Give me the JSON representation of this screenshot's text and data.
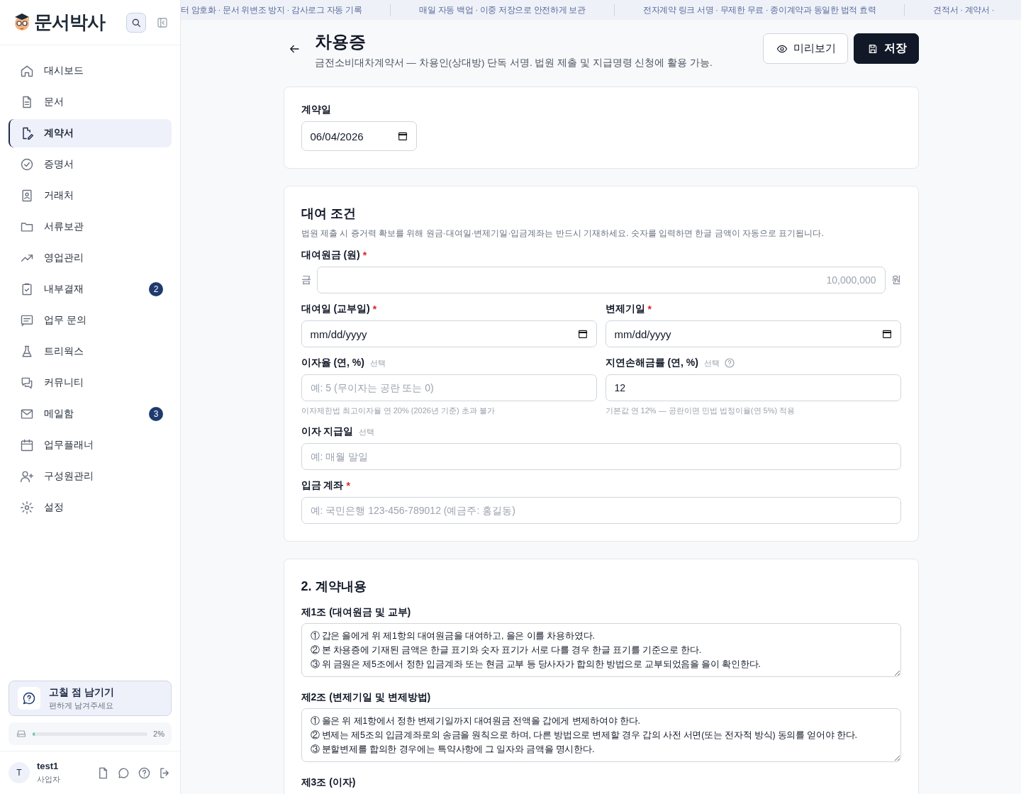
{
  "sidebar": {
    "logo": "문서박사",
    "nav": [
      {
        "label": "대시보드",
        "selected": false
      },
      {
        "label": "문서",
        "selected": false
      },
      {
        "label": "계약서",
        "selected": true
      },
      {
        "label": "증명서",
        "selected": false
      },
      {
        "label": "거래처",
        "selected": false
      },
      {
        "label": "서류보관",
        "selected": false
      },
      {
        "label": "영업관리",
        "selected": false
      },
      {
        "label": "내부결재",
        "selected": false,
        "badge": "2"
      },
      {
        "label": "업무 문의",
        "selected": false
      },
      {
        "label": "트리웍스",
        "selected": false
      },
      {
        "label": "커뮤니티",
        "selected": false
      },
      {
        "label": "메일함",
        "selected": false,
        "badge": "3"
      },
      {
        "label": "업무플래너",
        "selected": false
      },
      {
        "label": "구성원관리",
        "selected": false
      },
      {
        "label": "설정",
        "selected": false
      }
    ],
    "feedback": {
      "title": "고칠 점 남기기",
      "subtitle": "편하게 남겨주세요"
    },
    "storage": {
      "level": 0.02,
      "reading": "2%"
    },
    "user": {
      "avatar": "T",
      "name": "test1",
      "role": "사업자"
    }
  },
  "ticker": [
    "터 암호화 · 문서 위변조 방지 · 감사로그 자동 기록",
    "매일 자동 백업 · 이중 저장으로 안전하게 보관",
    "전자계약 링크 서명 · 무제한 무료 · 종이계약과 동일한 법적 효력",
    "견적서 · 계약서 ·"
  ],
  "header": {
    "title": "차용증",
    "subtitle": "금전소비대차계약서 — 차용인(상대방) 단독 서명. 법원 제출 및 지급명령 신청에 활용 가능.",
    "buttons": [
      {
        "label": "미리보기",
        "kind": "secondary"
      },
      {
        "label": "저장",
        "kind": "primary"
      }
    ]
  },
  "sections": [
    {
      "rows": [
        [
          {
            "kind": "date",
            "label": "계약일",
            "value": "06/04/2026",
            "help": false
          }
        ]
      ]
    },
    {
      "title": "대여 조건",
      "description": "법원 제출 시 증거력 확보를 위해 원금·대여일·변제기일·입금계좌는 반드시 기재하세요. 숫자를 입력하면 한글 금액이 자동으로 표기됩니다.",
      "rows": [
        [
          {
            "kind": "amount",
            "label": "대여원금 (원)",
            "required_mark": "*",
            "prefix": "금",
            "suffix": "원",
            "placeholder": "10,000,000",
            "help": false
          }
        ],
        [
          {
            "kind": "date",
            "label": "대여일 (교부일)",
            "required_mark": "*",
            "placeholder": "mm/dd/yyyy",
            "help": false
          },
          {
            "kind": "date",
            "label": "변제기일",
            "required_mark": "*",
            "placeholder": "mm/dd/yyyy",
            "help": false
          }
        ],
        [
          {
            "kind": "text",
            "label": "이자율 (연, %)",
            "optional_note": "선택",
            "placeholder": "예: 5 (무이자는 공란 또는 0)",
            "hint": "이자제한법 최고이자율 연 20% (2026년 기준) 초과 불가",
            "help": false
          },
          {
            "kind": "text",
            "label": "지연손해금률 (연, %)",
            "optional_note": "선택",
            "value": "12",
            "hint": "기본값 연 12% — 공란이면 민법 법정이율(연 5%) 적용",
            "help": true
          }
        ],
        [
          {
            "kind": "text",
            "label": "이자 지급일",
            "optional_note": "선택",
            "placeholder": "예: 매월 말일",
            "help": false
          }
        ],
        [
          {
            "kind": "text",
            "label": "입금 계좌",
            "required_mark": "*",
            "placeholder": "예: 국민은행 123-456-789012 (예금주: 홍길동)",
            "help": false
          }
        ]
      ]
    },
    {
      "title": "2. 계약내용",
      "articles": [
        {
          "title": "제1조 (대여원금 및 교부)",
          "text": "① 갑은 을에게 위 제1항의 대여원금을 대여하고, 을은 이를 차용하였다.\n② 본 차용증에 기재된 금액은 한글 표기와 숫자 표기가 서로 다를 경우 한글 표기를 기준으로 한다.\n③ 위 금원은 제5조에서 정한 입금계좌 또는 현금 교부 등 당사자가 합의한 방법으로 교부되었음을 을이 확인한다."
        },
        {
          "title": "제2조 (변제기일 및 변제방법)",
          "text": "① 을은 위 제1항에서 정한 변제기일까지 대여원금 전액을 갑에게 변제하여야 한다.\n② 변제는 제5조의 입금계좌로의 송금을 원칙으로 하며, 다른 방법으로 변제할 경우 갑의 사전 서면(또는 전자적 방식) 동의를 얻어야 한다.\n③ 분할변제를 합의한 경우에는 특약사항에 그 일자와 금액을 명시한다."
        },
        {
          "title": "제3조 (이자)"
        }
      ]
    }
  ]
}
